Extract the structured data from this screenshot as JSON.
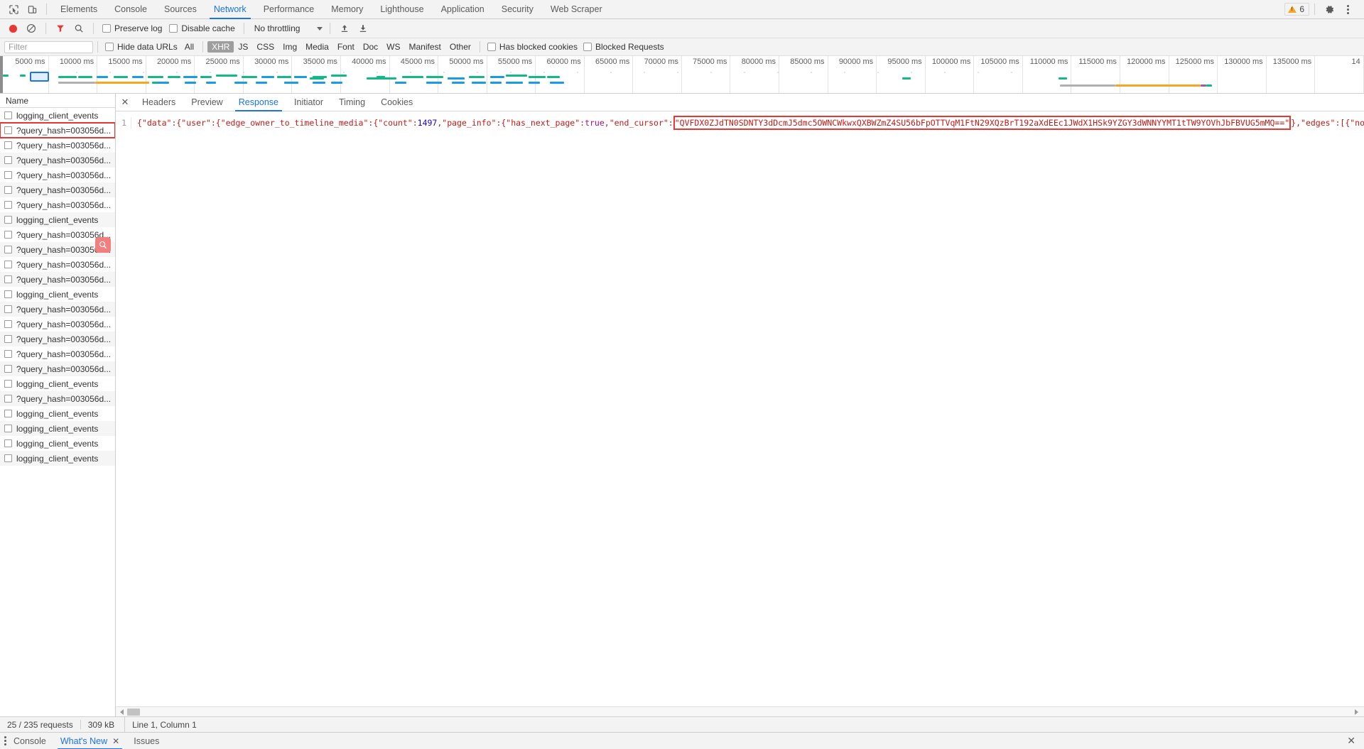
{
  "topbar": {
    "inspect_icon": "cursor-inspect-icon",
    "device_icon": "device-toggle-icon",
    "tabs": [
      {
        "label": "Elements",
        "active": false
      },
      {
        "label": "Console",
        "active": false
      },
      {
        "label": "Sources",
        "active": false
      },
      {
        "label": "Network",
        "active": true
      },
      {
        "label": "Performance",
        "active": false
      },
      {
        "label": "Memory",
        "active": false
      },
      {
        "label": "Lighthouse",
        "active": false
      },
      {
        "label": "Application",
        "active": false
      },
      {
        "label": "Security",
        "active": false
      },
      {
        "label": "Web Scraper",
        "active": false
      }
    ],
    "warning_count": "6",
    "settings_icon": "gear-icon",
    "more_icon": "kebab-menu-icon"
  },
  "network_toolbar": {
    "record_icon": "record-button-icon",
    "clear_icon": "clear-icon",
    "filter_icon": "funnel-filter-icon",
    "search_icon": "search-icon",
    "preserve_log_label": "Preserve log",
    "preserve_log_checked": false,
    "disable_cache_label": "Disable cache",
    "disable_cache_checked": false,
    "throttling_value": "No throttling",
    "import_icon": "import-har-icon",
    "export_icon": "export-har-icon"
  },
  "filter_row": {
    "filter_placeholder": "Filter",
    "filter_value": "",
    "hide_data_urls_label": "Hide data URLs",
    "hide_data_urls_checked": false,
    "types": [
      {
        "label": "All",
        "active": false
      },
      {
        "label": "XHR",
        "active": true
      },
      {
        "label": "JS",
        "active": false
      },
      {
        "label": "CSS",
        "active": false
      },
      {
        "label": "Img",
        "active": false
      },
      {
        "label": "Media",
        "active": false
      },
      {
        "label": "Font",
        "active": false
      },
      {
        "label": "Doc",
        "active": false
      },
      {
        "label": "WS",
        "active": false
      },
      {
        "label": "Manifest",
        "active": false
      },
      {
        "label": "Other",
        "active": false
      }
    ],
    "has_blocked_cookies_label": "Has blocked cookies",
    "has_blocked_cookies_checked": false,
    "blocked_requests_label": "Blocked Requests",
    "blocked_requests_checked": false
  },
  "overview": {
    "ticks": [
      "5000 ms",
      "10000 ms",
      "15000 ms",
      "20000 ms",
      "25000 ms",
      "30000 ms",
      "35000 ms",
      "40000 ms",
      "45000 ms",
      "50000 ms",
      "55000 ms",
      "60000 ms",
      "65000 ms",
      "70000 ms",
      "75000 ms",
      "80000 ms",
      "85000 ms",
      "90000 ms",
      "95000 ms",
      "100000 ms",
      "105000 ms",
      "110000 ms",
      "115000 ms",
      "120000 ms",
      "125000 ms",
      "130000 ms",
      "135000 ms",
      "14"
    ],
    "colors": {
      "green": "#12b886",
      "blue": "#1a9be6",
      "orange": "#f5a623",
      "gray": "#b0b0b0",
      "selection": "#1a73e8"
    }
  },
  "request_list": {
    "column_header": "Name",
    "magnifier_icon": "magnifier-search-icon",
    "rows": [
      {
        "name": "logging_client_events",
        "highlighted": false
      },
      {
        "name": "?query_hash=003056d...",
        "highlighted": true
      },
      {
        "name": "?query_hash=003056d...",
        "highlighted": false
      },
      {
        "name": "?query_hash=003056d...",
        "highlighted": false
      },
      {
        "name": "?query_hash=003056d...",
        "highlighted": false
      },
      {
        "name": "?query_hash=003056d...",
        "highlighted": false
      },
      {
        "name": "?query_hash=003056d...",
        "highlighted": false
      },
      {
        "name": "logging_client_events",
        "highlighted": false
      },
      {
        "name": "?query_hash=003056d...",
        "highlighted": false
      },
      {
        "name": "?query_hash=003056d...",
        "highlighted": false
      },
      {
        "name": "?query_hash=003056d...",
        "highlighted": false
      },
      {
        "name": "?query_hash=003056d...",
        "highlighted": false
      },
      {
        "name": "logging_client_events",
        "highlighted": false
      },
      {
        "name": "?query_hash=003056d...",
        "highlighted": false
      },
      {
        "name": "?query_hash=003056d...",
        "highlighted": false
      },
      {
        "name": "?query_hash=003056d...",
        "highlighted": false
      },
      {
        "name": "?query_hash=003056d...",
        "highlighted": false
      },
      {
        "name": "?query_hash=003056d...",
        "highlighted": false
      },
      {
        "name": "logging_client_events",
        "highlighted": false
      },
      {
        "name": "?query_hash=003056d...",
        "highlighted": false
      },
      {
        "name": "logging_client_events",
        "highlighted": false
      },
      {
        "name": "logging_client_events",
        "highlighted": false
      },
      {
        "name": "logging_client_events",
        "highlighted": false
      },
      {
        "name": "logging_client_events",
        "highlighted": false
      }
    ]
  },
  "detail": {
    "close_icon": "close-icon",
    "tabs": [
      {
        "label": "Headers",
        "active": false
      },
      {
        "label": "Preview",
        "active": false
      },
      {
        "label": "Response",
        "active": true
      },
      {
        "label": "Initiator",
        "active": false
      },
      {
        "label": "Timing",
        "active": false
      },
      {
        "label": "Cookies",
        "active": false
      }
    ],
    "line_number": "1",
    "response": {
      "prefix": "{\"data\":{\"user\":{\"edge_owner_to_timeline_media\":{\"count\":",
      "count": "1497",
      "mid": ",\"page_info\":{\"has_next_page\":",
      "has_next_page": "true",
      "cursor_key": ",\"end_cursor\":",
      "cursor_value": "\"QVFDX0ZJdTN0SDNTY3dDcmJ5dmc5OWNCWkwxQXBWZmZ4SU56bFpOTTVqM1FtN29XQzBrT192aXdEEc1JWdX1HSk9YZGY3dWNNYYMT1tTW9YOVhJbFBVUG5mMQ==\"",
      "suffix": "},\"edges\":[{\"node\":{\"__typen"
    }
  },
  "status_bar": {
    "requests": "25 / 235 requests",
    "transferred": "309 kB",
    "cursor_position": "Line 1, Column 1"
  },
  "drawer": {
    "more_icon": "kebab-menu-icon",
    "tabs": [
      {
        "label": "Console",
        "active": false,
        "closable": false
      },
      {
        "label": "What's New",
        "active": true,
        "closable": true
      },
      {
        "label": "Issues",
        "active": false,
        "closable": false
      }
    ],
    "close_icon": "close-drawer-icon"
  }
}
